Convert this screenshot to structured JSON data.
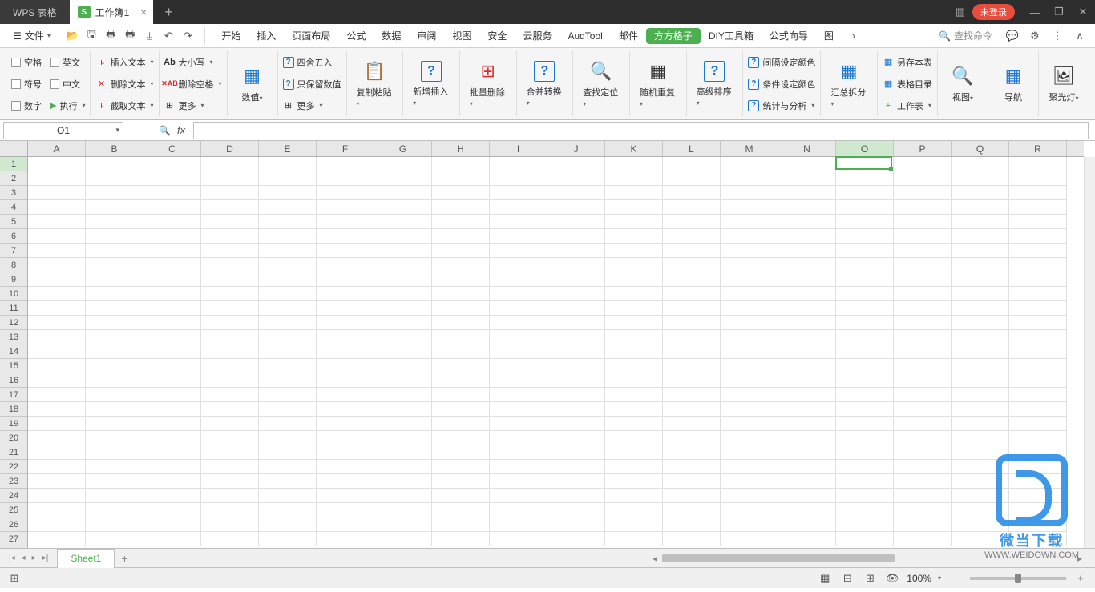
{
  "titlebar": {
    "app_name": "WPS 表格",
    "doc_name": "工作簿1",
    "login_badge": "未登录"
  },
  "menubar": {
    "file_label": "文件",
    "tabs": [
      "开始",
      "插入",
      "页面布局",
      "公式",
      "数据",
      "审阅",
      "视图",
      "安全",
      "云服务",
      "AudTool",
      "邮件",
      "方方格子",
      "DIY工具箱",
      "公式向导",
      "图"
    ],
    "active_tab_index": 11,
    "search_placeholder": "查找命令"
  },
  "ribbon": {
    "g1": {
      "a": "空格",
      "b": "英文",
      "c": "符号",
      "d": "中文",
      "e": "数字",
      "f": "执行"
    },
    "g2": {
      "a": "插入文本",
      "b": "删除文本",
      "c": "截取文本"
    },
    "g3": {
      "a": "大小写",
      "b": "删除空格",
      "c": "更多"
    },
    "g4": "数值",
    "g5": {
      "a": "四舍五入",
      "b": "只保留数值",
      "c": "更多"
    },
    "g6": "复制粘贴",
    "g7": "新增插入",
    "g8": "批量删除",
    "g9": "合并转换",
    "g10": "查找定位",
    "g11": "随机重复",
    "g12": "高级排序",
    "g13": {
      "a": "间隔设定颜色",
      "b": "条件设定颜色",
      "c": "统计与分析"
    },
    "g14": "汇总拆分",
    "g15": {
      "a": "另存本表",
      "b": "表格目录",
      "c": "工作表"
    },
    "g16": "视图",
    "g17": "导航",
    "g18": "聚光灯"
  },
  "formula": {
    "cell_ref": "O1"
  },
  "grid": {
    "columns": [
      "A",
      "B",
      "C",
      "D",
      "E",
      "F",
      "G",
      "H",
      "I",
      "J",
      "K",
      "L",
      "M",
      "N",
      "O",
      "P",
      "Q",
      "R"
    ],
    "rows": 27,
    "active_col_index": 14,
    "active_row_index": 0
  },
  "sheets": {
    "active": "Sheet1"
  },
  "statusbar": {
    "zoom": "100%"
  },
  "watermark": {
    "text": "微当下载",
    "url": "WWW.WEIDOWN.COM"
  }
}
